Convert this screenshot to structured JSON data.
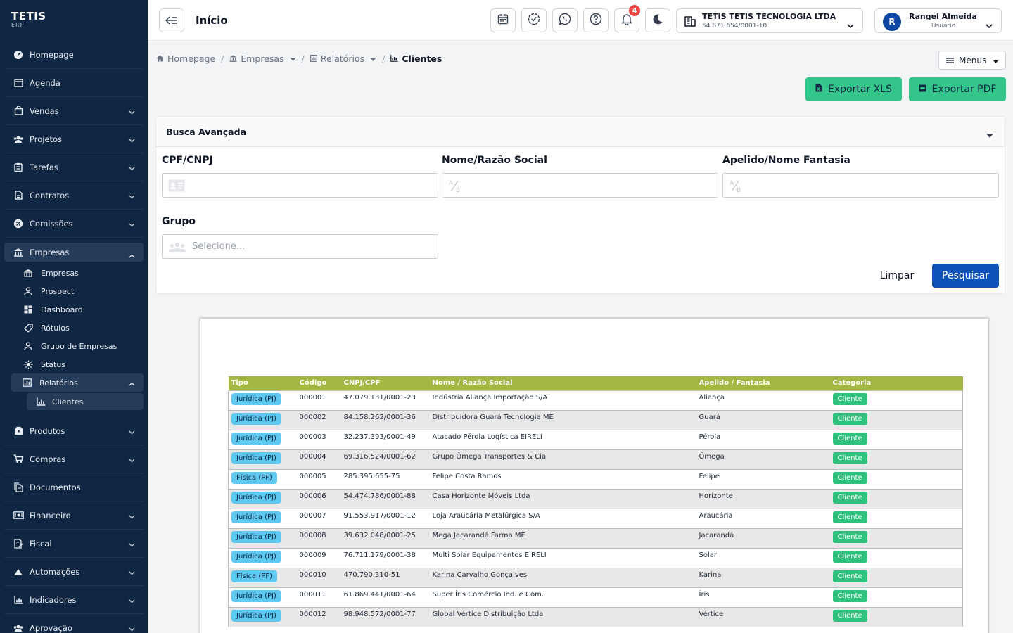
{
  "app": {
    "brand": "TETIS",
    "brand_sub": "ERP"
  },
  "header": {
    "title": "Início",
    "notifications_count": "4",
    "company_name": "TETIS TETIS TECNOLOGIA LTDA",
    "company_id": "54.871.654/0001-10",
    "user_initial": "R",
    "user_name": "Rangel Almeida",
    "user_role": "Usuário"
  },
  "sidebar": {
    "items": [
      {
        "label": "Homepage"
      },
      {
        "label": "Agenda"
      },
      {
        "label": "Vendas"
      },
      {
        "label": "Projetos"
      },
      {
        "label": "Tarefas"
      },
      {
        "label": "Contratos"
      },
      {
        "label": "Comissões"
      },
      {
        "label": "Empresas"
      },
      {
        "label": "Produtos"
      },
      {
        "label": "Compras"
      },
      {
        "label": "Documentos"
      },
      {
        "label": "Financeiro"
      },
      {
        "label": "Fiscal"
      },
      {
        "label": "Automações"
      },
      {
        "label": "Indicadores"
      },
      {
        "label": "Aprovação"
      }
    ],
    "empresas_sub": [
      {
        "label": "Empresas"
      },
      {
        "label": "Prospect"
      },
      {
        "label": "Dashboard"
      },
      {
        "label": "Rótulos"
      },
      {
        "label": "Grupo de Empresas"
      },
      {
        "label": "Status"
      },
      {
        "label": "Relatórios"
      }
    ],
    "relatorios_sub": [
      {
        "label": "Clientes"
      }
    ]
  },
  "breadcrumb": {
    "home": "Homepage",
    "empresas": "Empresas",
    "relatorios": "Relatórios",
    "current": "Clientes",
    "menus": "Menus"
  },
  "actions": {
    "export_xls": "Exportar XLS",
    "export_pdf": "Exportar PDF"
  },
  "search": {
    "title": "Busca Avançada",
    "cpf_label": "CPF/CNPJ",
    "nome_label": "Nome/Razão Social",
    "apelido_label": "Apelido/Nome Fantasia",
    "grupo_label": "Grupo",
    "grupo_placeholder": "Selecione...",
    "clear": "Limpar",
    "submit": "Pesquisar"
  },
  "report": {
    "columns": [
      "Tipo",
      "Código",
      "CNPJ/CPF",
      "Nome / Razão Social",
      "Apelido / Fantasia",
      "Categoria"
    ],
    "rows": [
      [
        "Jurídica (PJ)",
        "000001",
        "47.079.131/0001-23",
        "Indústria Aliança Importação S/A",
        "Aliança",
        "Cliente"
      ],
      [
        "Jurídica (PJ)",
        "000002",
        "84.158.262/0001-36",
        "Distribuidora Guará Tecnologia ME",
        "Guará",
        "Cliente"
      ],
      [
        "Jurídica (PJ)",
        "000003",
        "32.237.393/0001-49",
        "Atacado Pérola Logística EIRELI",
        "Pérola",
        "Cliente"
      ],
      [
        "Jurídica (PJ)",
        "000004",
        "69.316.524/0001-62",
        "Grupo Ômega Transportes & Cia",
        "Ômega",
        "Cliente"
      ],
      [
        "Física (PF)",
        "000005",
        "285.395.655-75",
        "Felipe Costa Ramos",
        "Felipe",
        "Cliente"
      ],
      [
        "Jurídica (PJ)",
        "000006",
        "54.474.786/0001-88",
        "Casa Horizonte Móveis Ltda",
        "Horizonte",
        "Cliente"
      ],
      [
        "Jurídica (PJ)",
        "000007",
        "91.553.917/0001-12",
        "Loja Araucária Metalúrgica S/A",
        "Araucária",
        "Cliente"
      ],
      [
        "Jurídica (PJ)",
        "000008",
        "39.632.048/0001-25",
        "Mega Jacarandá Farma ME",
        "Jacarandá",
        "Cliente"
      ],
      [
        "Jurídica (PJ)",
        "000009",
        "76.711.179/0001-38",
        "Multi Solar Equipamentos EIRELI",
        "Solar",
        "Cliente"
      ],
      [
        "Física (PF)",
        "000010",
        "470.790.310-51",
        "Karina Carvalho Gonçalves",
        "Karina",
        "Cliente"
      ],
      [
        "Jurídica (PJ)",
        "000011",
        "61.869.441/0001-64",
        "Super Íris Comércio Ind. e Com.",
        "Íris",
        "Cliente"
      ],
      [
        "Jurídica (PJ)",
        "000012",
        "98.948.572/0001-77",
        "Global Vértice Distribuição Ltda",
        "Vértice",
        "Cliente"
      ]
    ]
  },
  "colors": {
    "sidebar_bg": "#0f2742",
    "accent_blue": "#0d52b6",
    "export_green": "#34c58a",
    "table_header": "#a3b744",
    "tipo_pill": "#5ec8f0",
    "categoria_pill": "#2ec27e"
  }
}
